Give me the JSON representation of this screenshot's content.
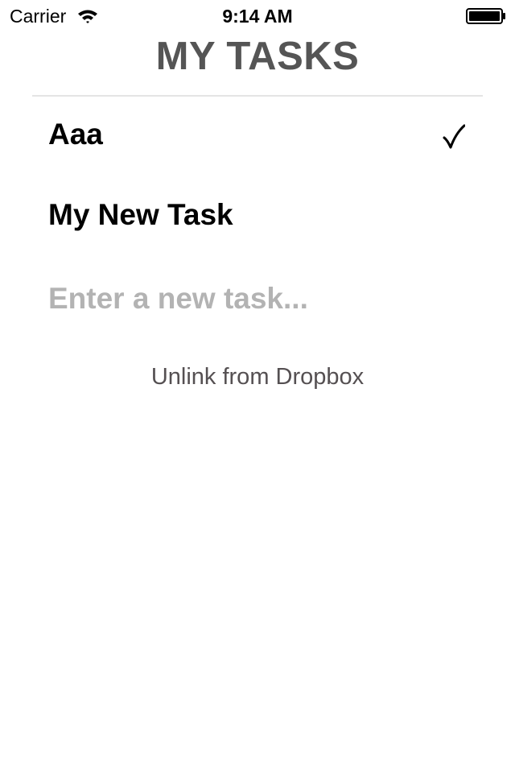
{
  "status_bar": {
    "carrier": "Carrier",
    "time": "9:14 AM",
    "icons": [
      "wifi-icon",
      "battery-icon"
    ]
  },
  "header": {
    "title": "MY TASKS"
  },
  "tasks": [
    {
      "label": "Aaa",
      "completed": true
    },
    {
      "label": "My New Task",
      "completed": false
    }
  ],
  "new_task": {
    "placeholder": "Enter a new task...",
    "value": ""
  },
  "unlink": {
    "label": "Unlink from Dropbox"
  },
  "colors": {
    "title": "#555555",
    "placeholder": "#b3b3b3",
    "divider": "#e4e4e4",
    "link": "#555052"
  }
}
